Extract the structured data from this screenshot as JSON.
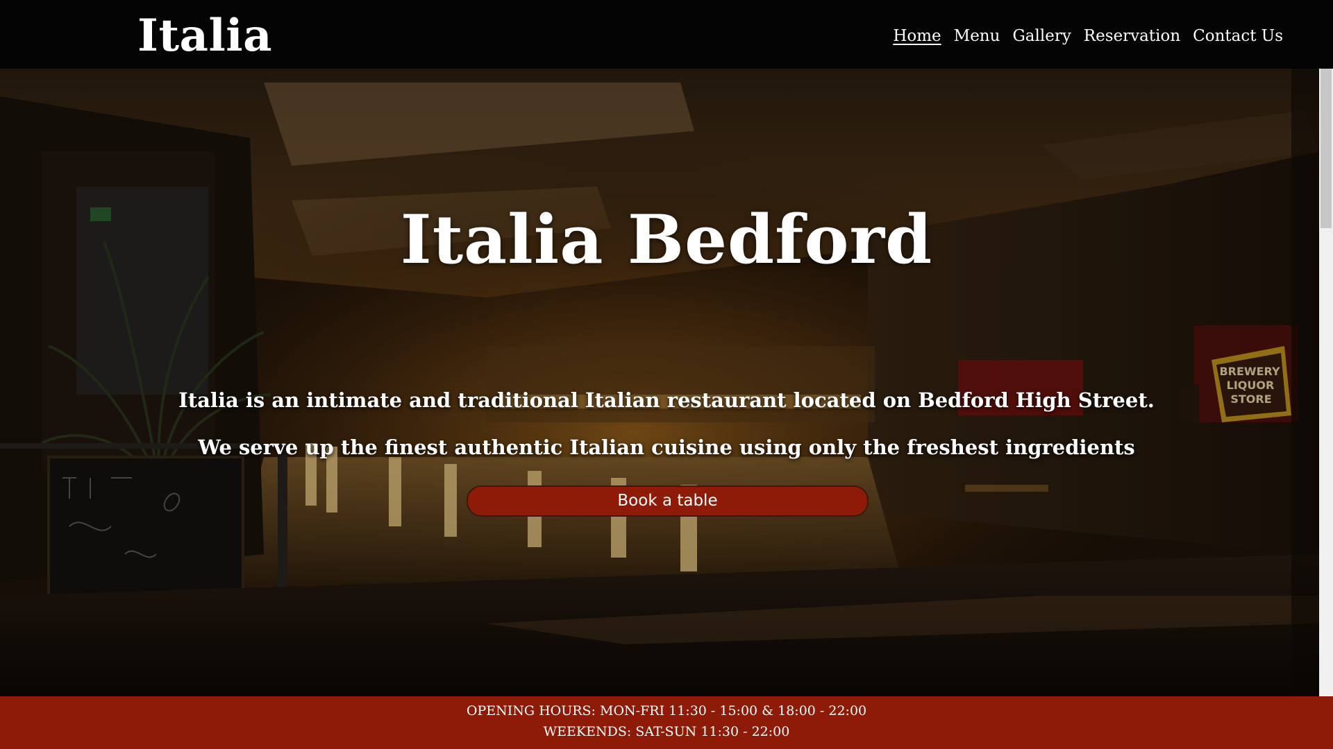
{
  "header": {
    "logo": "Italia",
    "nav": [
      {
        "label": "Home",
        "active": true
      },
      {
        "label": "Menu"
      },
      {
        "label": "Gallery"
      },
      {
        "label": "Reservation"
      },
      {
        "label": "Contact Us"
      }
    ]
  },
  "hero": {
    "title": "Italia Bedford",
    "line1": "Italia is an intimate and traditional Italian restaurant located on Bedford High Street.",
    "line2": "We serve up the finest authentic Italian cuisine using only the freshest ingredients",
    "button": "Book a table",
    "background_sign": "BREWERY LIQUOR STORE"
  },
  "opening_hours": {
    "line1": "OPENING HOURS: MON-FRI 11:30 - 15:00 & 18:00 - 22:00",
    "line2": "WEEKENDS: SAT-SUN 11:30 - 22:00"
  },
  "colors": {
    "header_bg": "#040404",
    "accent": "#8e1a08",
    "text": "#ffffff"
  }
}
